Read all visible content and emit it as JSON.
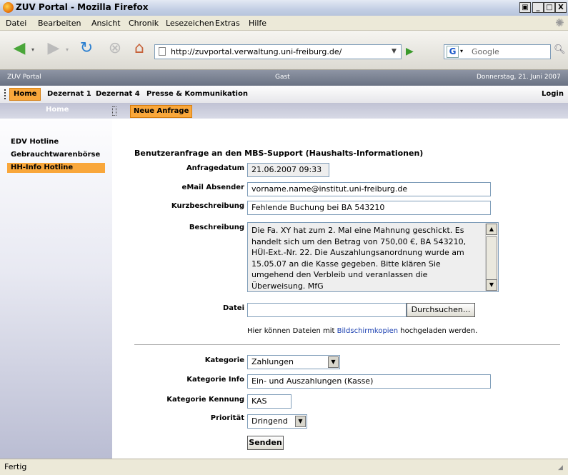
{
  "window": {
    "title": "ZUV Portal - Mozilla Firefox"
  },
  "menu": [
    "Datei",
    "Bearbeiten",
    "Ansicht",
    "Chronik",
    "Lesezeichen",
    "Extras",
    "Hilfe"
  ],
  "nav": {
    "url": "http://zuvportal.verwaltung.uni-freiburg.de/",
    "search_placeholder": "Google"
  },
  "portal": {
    "name": "ZUV Portal",
    "user": "Gast",
    "date": "Donnerstag, 21. Juni 2007"
  },
  "tabs": [
    "Home",
    "Dezernat 1",
    "Dezernat 4",
    "Presse & Kommunikation"
  ],
  "login": "Login",
  "sub": {
    "home": "Home",
    "new_request": "Neue Anfrage"
  },
  "sidebar": [
    "EDV Hotline",
    "Gebrauchtwarenbörse",
    "HH-Info Hotline"
  ],
  "form": {
    "heading": "Benutzeranfrage an den MBS-Support (Haushalts-Informationen)",
    "date_label": "Anfragedatum",
    "date_value": "21.06.2007 09:33",
    "email_label": "eMail Absender",
    "email_value": "vorname.name@institut.uni-freiburg.de",
    "summary_label": "Kurzbeschreibung",
    "summary_value": "Fehlende Buchung bei BA 543210",
    "desc_label": "Beschreibung",
    "desc_value": "Die Fa. XY hat zum 2. Mal eine Mahnung geschickt. Es handelt sich um den Betrag von 750,00 €, BA 543210, HÜl-Ext.-Nr. 22. Die Auszahlungsanordnung wurde am 15.05.07 an die Kasse gegeben. Bitte klären Sie umgehend den Verbleib und veranlassen die Überweisung. MfG",
    "file_label": "Datei",
    "browse_button": "Durchsuchen...",
    "hint_before": "Hier können Dateien mit",
    "hint_link": "Bildschirmkopien",
    "hint_after": "hochgeladen werden.",
    "category_label": "Kategorie",
    "category_value": "Zahlungen",
    "category_info_label": "Kategorie Info",
    "category_info_value": "Ein- und Auszahlungen (Kasse)",
    "category_code_label": "Kategorie Kennung",
    "category_code_value": "KAS",
    "priority_label": "Priorität",
    "priority_value": "Dringend",
    "submit": "Senden"
  },
  "status": "Fertig",
  "colors": {
    "accent_orange": "#f9a73b",
    "link_blue": "#1a3fb0"
  }
}
